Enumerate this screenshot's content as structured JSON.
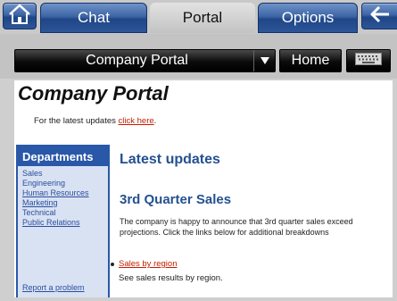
{
  "tabs": {
    "chat": "Chat",
    "portal": "Portal",
    "options": "Options"
  },
  "toolbar": {
    "address": "Company Portal",
    "home": "Home"
  },
  "page": {
    "title": "Company Portal",
    "latest_prefix": "For the latest updates ",
    "latest_link": "click here",
    "latest_suffix": ".",
    "sidebar": {
      "heading": "Departments",
      "items": [
        "Sales",
        "Engineering",
        "Human Resources",
        "Marketing",
        "Technical",
        "Public Relations"
      ],
      "report": "Report a problem"
    },
    "main_heading": "Latest updates",
    "section_heading": "3rd Quarter Sales",
    "section_line1": "The company is happy to announce that 3rd quarter sales exceed",
    "section_line2": "projections. Click the links below for additional breakdowns",
    "sales_link": "Sales by region",
    "sales_desc": "See sales results by region."
  }
}
